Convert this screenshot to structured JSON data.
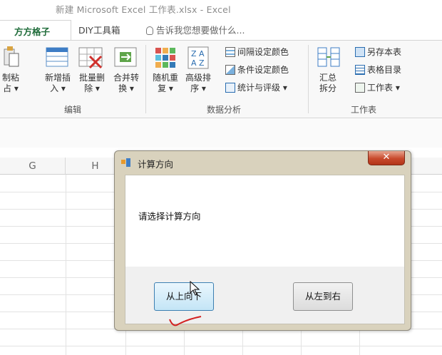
{
  "window": {
    "title": "新建 Microsoft Excel 工作表.xlsx - Excel"
  },
  "tabs": [
    {
      "label": "方方格子"
    },
    {
      "label": "DIY工具箱"
    },
    {
      "label": "告诉我您想要做什么..."
    }
  ],
  "ribbon": {
    "edit_group": {
      "label": "编辑",
      "buttons": [
        {
          "line1": "制粘",
          "line2": "占 ▾"
        },
        {
          "line1": "新增插",
          "line2": "入 ▾"
        },
        {
          "line1": "批量删",
          "line2": "除 ▾"
        },
        {
          "line1": "合并转",
          "line2": "换 ▾"
        }
      ]
    },
    "data_group": {
      "label": "数据分析",
      "buttons": [
        {
          "line1": "随机重",
          "line2": "复 ▾"
        },
        {
          "line1": "高级排",
          "line2": "序 ▾"
        }
      ],
      "small_buttons": [
        {
          "label": "间隔设定颜色"
        },
        {
          "label": "条件设定颜色"
        },
        {
          "label": "统计与评级 ▾"
        }
      ]
    },
    "worksheet_group": {
      "label": "工作表",
      "summary_button": {
        "line1": "汇总",
        "line2": "拆分"
      },
      "small_buttons": [
        {
          "label": "另存本表"
        },
        {
          "label": "表格目录"
        },
        {
          "label": "工作表 ▾"
        }
      ]
    }
  },
  "sheet": {
    "columns": [
      "G",
      "H"
    ]
  },
  "dialog": {
    "title": "计算方向",
    "close_label": "✕",
    "prompt": "请选择计算方向",
    "buttons": [
      {
        "label": "从上向下"
      },
      {
        "label": "从左到右"
      }
    ]
  },
  "colors": {
    "active_tab_text": "#1e6b39",
    "close_button": "#c84a2c",
    "primary_button_border": "#3c7fb1",
    "annotation_mark": "#d32020"
  }
}
